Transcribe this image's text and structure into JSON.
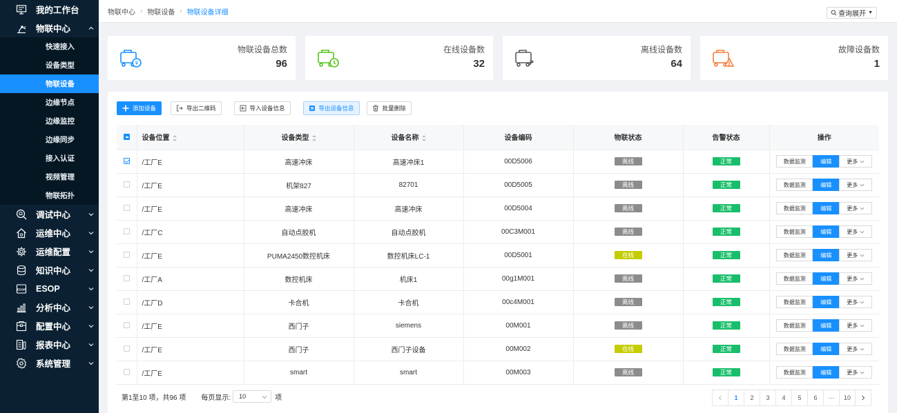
{
  "sidebar": {
    "top_items": [
      {
        "label": "我的工作台",
        "icon": "monitor-icon"
      },
      {
        "label": "物联中心",
        "icon": "robot-arm-icon",
        "expanded": true
      }
    ],
    "sub_items": [
      {
        "label": "快速接入"
      },
      {
        "label": "设备类型"
      },
      {
        "label": "物联设备",
        "active": true
      },
      {
        "label": "边缘节点"
      },
      {
        "label": "边缘监控"
      },
      {
        "label": "边缘同步"
      },
      {
        "label": "接入认证"
      },
      {
        "label": "视频管理"
      },
      {
        "label": "物联拓扑"
      }
    ],
    "bottom_items": [
      {
        "label": "调试中心",
        "icon": "debug-icon"
      },
      {
        "label": "运维中心",
        "icon": "home-gear-icon"
      },
      {
        "label": "运维配置",
        "icon": "gear-icon"
      },
      {
        "label": "知识中心",
        "icon": "database-icon"
      },
      {
        "label": "ESOP",
        "icon": "esop-icon"
      },
      {
        "label": "分析中心",
        "icon": "bar-chart-icon"
      },
      {
        "label": "配置中心",
        "icon": "config-icon"
      },
      {
        "label": "报表中心",
        "icon": "report-icon"
      },
      {
        "label": "系统管理",
        "icon": "settings-icon"
      }
    ]
  },
  "breadcrumb": [
    "物联中心",
    "物联设备",
    "物联设备详细"
  ],
  "query_toggle": "查询展开",
  "stats": [
    {
      "title": "物联设备总数",
      "value": "96",
      "color": "#1890ff"
    },
    {
      "title": "在线设备数",
      "value": "32",
      "color": "#52c41a"
    },
    {
      "title": "离线设备数",
      "value": "64",
      "color": "#595959"
    },
    {
      "title": "故障设备数",
      "value": "1",
      "color": "#fa7d3c"
    }
  ],
  "toolbar": {
    "add": "添加设备",
    "export_qr": "导出二维码",
    "import": "导入设备信息",
    "export": "导出设备信息",
    "batch_delete": "批量删除"
  },
  "table": {
    "headers": [
      "设备位置",
      "设备类型",
      "设备名称",
      "设备编码",
      "物联状态",
      "告警状态",
      "操作"
    ],
    "rows": [
      {
        "loc": "/工厂E",
        "type": "高速冲床",
        "name": "高速冲床1",
        "code": "00D5006",
        "iot": "离线",
        "iot_state": "offline",
        "alarm": "正常",
        "checked": true
      },
      {
        "loc": "/工厂E",
        "type": "机架827",
        "name": "82701",
        "code": "00D5005",
        "iot": "离线",
        "iot_state": "offline",
        "alarm": "正常",
        "checked": false
      },
      {
        "loc": "/工厂E",
        "type": "高速冲床",
        "name": "高速冲床",
        "code": "00D5004",
        "iot": "离线",
        "iot_state": "offline",
        "alarm": "正常",
        "checked": false
      },
      {
        "loc": "/工厂C",
        "type": "自动点胶机",
        "name": "自动点胶机",
        "code": "00C3M001",
        "iot": "离线",
        "iot_state": "offline",
        "alarm": "正常",
        "checked": false
      },
      {
        "loc": "/工厂E",
        "type": "PUMA2450数控机床",
        "name": "数控机床LC-1",
        "code": "00D5001",
        "iot": "在线",
        "iot_state": "online",
        "alarm": "正常",
        "checked": false
      },
      {
        "loc": "/工厂A",
        "type": "数控机床",
        "name": "机床1",
        "code": "00g1M001",
        "iot": "离线",
        "iot_state": "offline",
        "alarm": "正常",
        "checked": false
      },
      {
        "loc": "/工厂D",
        "type": "卡合机",
        "name": "卡合机",
        "code": "00c4M001",
        "iot": "离线",
        "iot_state": "offline",
        "alarm": "正常",
        "checked": false
      },
      {
        "loc": "/工厂E",
        "type": "西门子",
        "name": "siemens",
        "code": "00M001",
        "iot": "离线",
        "iot_state": "offline",
        "alarm": "正常",
        "checked": false
      },
      {
        "loc": "/工厂E",
        "type": "西门子",
        "name": "西门子设备",
        "code": "00M002",
        "iot": "在线",
        "iot_state": "online",
        "alarm": "正常",
        "checked": false
      },
      {
        "loc": "/工厂E",
        "type": "smart",
        "name": "smart",
        "code": "00M003",
        "iot": "离线",
        "iot_state": "offline",
        "alarm": "正常",
        "checked": false
      }
    ],
    "row_actions": {
      "monitor": "数据监测",
      "edit": "编辑",
      "more": "更多"
    }
  },
  "footer": {
    "summary": "第1至10 项，共96 项",
    "page_size_label": "每页显示:",
    "page_size": "10",
    "page_size_unit": "项"
  },
  "pagination": {
    "pages": [
      "1",
      "2",
      "3",
      "4",
      "5",
      "6",
      "···",
      "10"
    ],
    "current": "1"
  }
}
